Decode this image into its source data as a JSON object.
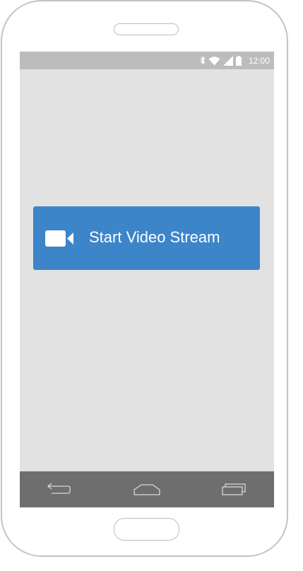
{
  "status_bar": {
    "time": "12:00",
    "icons": [
      "bluetooth-icon",
      "wifi-icon",
      "signal-icon",
      "battery-icon"
    ]
  },
  "main": {
    "stream_button_label": "Start Video Stream",
    "stream_button_icon": "video-camera-icon"
  },
  "nav_bar": {
    "buttons": [
      "back-icon",
      "home-icon",
      "recent-apps-icon"
    ]
  },
  "colors": {
    "button_accent": "#3d85c9",
    "screen_background": "#e2e2e2",
    "status_bar": "#bcbcbc",
    "nav_bar": "#6e6e6e"
  }
}
